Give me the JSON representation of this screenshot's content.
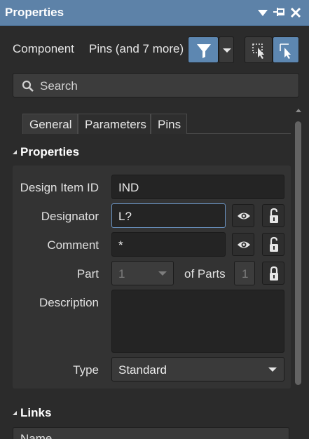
{
  "window": {
    "title": "Properties"
  },
  "filter_bar": {
    "object_kind": "Component",
    "filter_summary": "Pins (and 7 more)"
  },
  "search": {
    "placeholder": "Search"
  },
  "tabs": [
    {
      "label": "General",
      "active": true
    },
    {
      "label": "Parameters",
      "active": false
    },
    {
      "label": "Pins",
      "active": false
    }
  ],
  "properties_section": {
    "heading": "Properties",
    "design_item_id": {
      "label": "Design Item ID",
      "value": "IND"
    },
    "designator": {
      "label": "Designator",
      "value": "L?"
    },
    "comment": {
      "label": "Comment",
      "value": "*"
    },
    "part": {
      "label": "Part",
      "value": "1",
      "of_parts_label": "of Parts",
      "of_parts_value": "1"
    },
    "description": {
      "label": "Description",
      "value": ""
    },
    "type": {
      "label": "Type",
      "value": "Standard"
    }
  },
  "links_section": {
    "heading": "Links",
    "columns": [
      "Name"
    ]
  },
  "colors": {
    "titlebar": "#5d82a8",
    "accent_button": "#5d87b1",
    "background": "#2b2b2b",
    "panel": "#333333",
    "field": "#242424",
    "focus_border": "#6a93c2"
  }
}
